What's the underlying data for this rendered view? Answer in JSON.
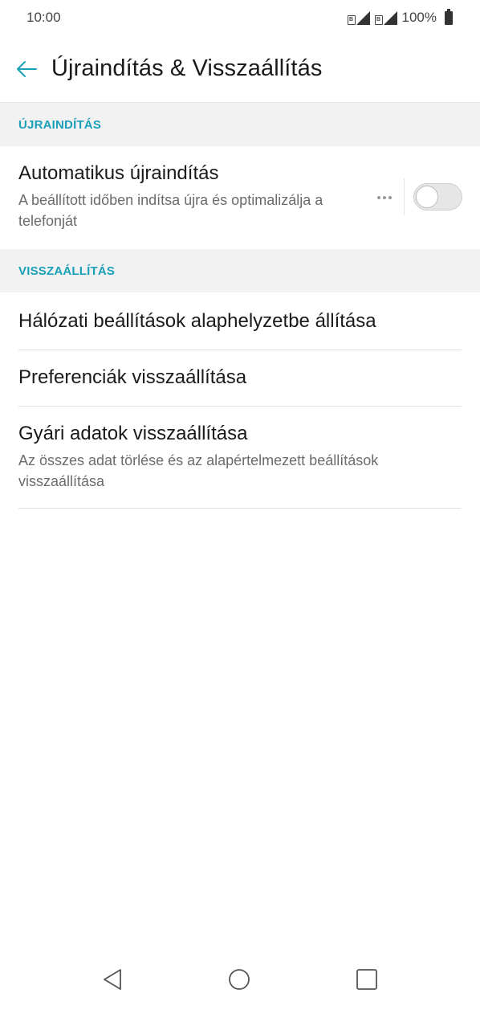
{
  "status": {
    "time": "10:00",
    "sim1_label": "B",
    "sim2_label": "B",
    "battery": "100%"
  },
  "header": {
    "title": "Újraindítás & Visszaállítás"
  },
  "sections": {
    "restart": {
      "header": "ÚJRAINDÍTÁS",
      "auto_restart": {
        "title": "Automatikus újraindítás",
        "subtitle": "A beállított időben indítsa újra és optimalizálja a telefonját",
        "toggle_on": false
      }
    },
    "reset": {
      "header": "VISSZAÁLLÍTÁS",
      "network_reset": {
        "title": "Hálózati beállítások alaphelyzetbe állítása"
      },
      "preferences_reset": {
        "title": "Preferenciák visszaállítása"
      },
      "factory_reset": {
        "title": "Gyári adatok visszaállítása",
        "subtitle": "Az összes adat törlése és az alapértelmezett beállítások visszaállítása"
      }
    }
  },
  "colors": {
    "accent": "#1aa0b8",
    "section_bg": "#f2f2f2",
    "text_primary": "#1a1a1a",
    "text_secondary": "#6b6b6b"
  },
  "icons": {
    "back": "arrow-left-icon",
    "more": "more-horizontal-icon",
    "nav_back": "triangle-back-icon",
    "nav_home": "circle-home-icon",
    "nav_recents": "square-recents-icon"
  }
}
